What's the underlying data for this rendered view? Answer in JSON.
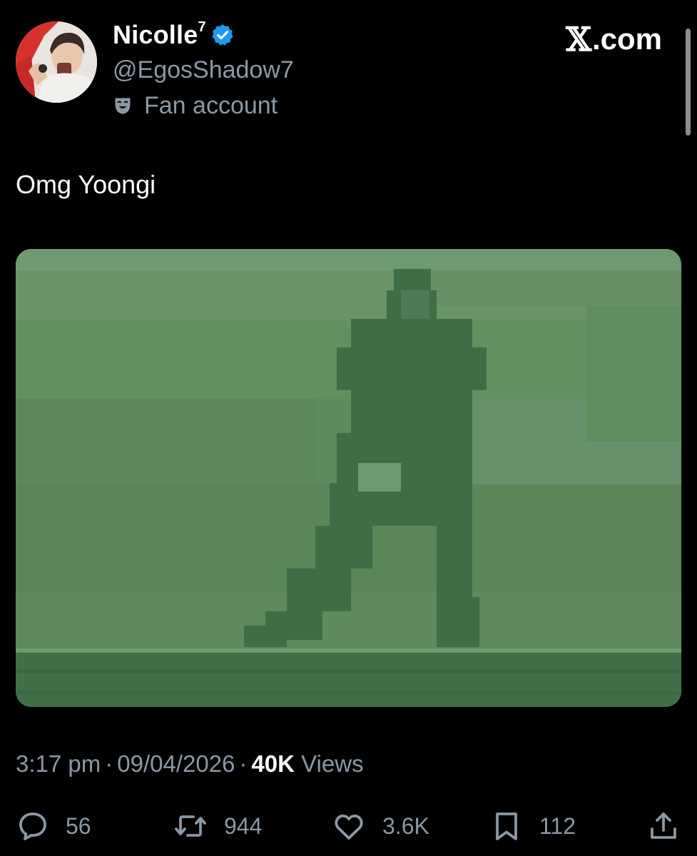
{
  "author": {
    "display_name": "Nicolle",
    "display_name_suffix": "7",
    "handle": "@EgosShadow7",
    "account_label": "Fan account",
    "verified": true
  },
  "brand": {
    "site_label": ".com",
    "logo_glyph": "𝕏"
  },
  "tweet": {
    "text": "Omg Yoongi"
  },
  "meta": {
    "time": "3:17 pm",
    "date": "09/04/2026",
    "views_count": "40K",
    "views_label": "Views",
    "separator": "·"
  },
  "actions": {
    "replies": "56",
    "reposts": "944",
    "likes": "3.6K",
    "bookmarks": "112"
  },
  "colors": {
    "background": "#000000",
    "primary_text": "#e7e9ea",
    "secondary_text": "#8b98a5",
    "verified_blue": "#1d9bf0",
    "avatar_ring": "#e0342f",
    "media_tint": "#5e8a60"
  },
  "icons": {
    "verified": "verified-badge-icon",
    "label": "theater-mask-icon",
    "reply": "speech-bubble-icon",
    "repost": "repost-arrows-icon",
    "like": "heart-icon",
    "bookmark": "bookmark-icon",
    "share": "share-icon"
  }
}
